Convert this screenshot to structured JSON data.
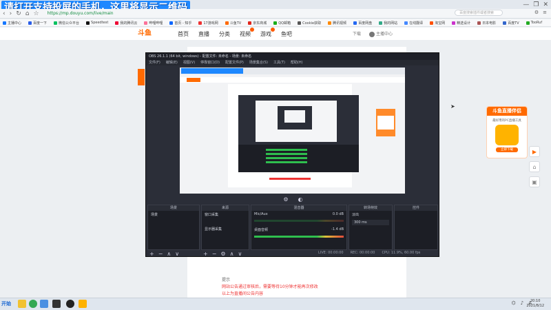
{
  "browser": {
    "banner_text": "请打开支持投屏的手机，这里将显示二维码",
    "url": "https://mp.douyu.com/live/main",
    "search_placeholder": "百度搜索插件或者搜索",
    "bookmarks": [
      "主播中心",
      "百度一下",
      "微信公众平台",
      "Speedtest",
      "我的腾讯云",
      "哔哩哔哩",
      "首页 - 知乎",
      "17游戏网",
      "斗鱼TV",
      "京东商城",
      "QQ邮箱",
      "Cookie获取",
      "腾讯视频",
      "百度网盘",
      "我的网站",
      "在线翻译",
      "淘宝网",
      "精选设计",
      "日本电影",
      "百度TV",
      "TooRuf",
      "更多"
    ],
    "window_controls": [
      "—",
      "❐",
      "✕"
    ]
  },
  "site": {
    "logo": "斗鱼",
    "nav": [
      "首页",
      "直播",
      "分类",
      "视频",
      "游戏",
      "鱼吧"
    ],
    "nav_badges": [
      false,
      false,
      false,
      true,
      true,
      false
    ],
    "right_items": [
      "下载",
      "主播中心"
    ]
  },
  "obs": {
    "title": "OBS 26.1.1 (64 bit, windows) - 配置文件: 未命名 - 场景: 未命名",
    "menu": [
      "文件(F)",
      "编辑(E)",
      "视图(V)",
      "停靠窗口(D)",
      "配置文件(P)",
      "场景集合(S)",
      "工具(T)",
      "帮助(H)"
    ],
    "docks": {
      "scenes": {
        "title": "场景",
        "items": [
          "场景"
        ]
      },
      "sources": {
        "title": "来源",
        "items": [
          "窗口采集",
          "显示器采集"
        ]
      },
      "mixer": {
        "title": "混音器",
        "channels": [
          {
            "name": "Mic/Aux",
            "db": "0.0 dB",
            "level": 0.0
          },
          {
            "name": "桌面音频",
            "db": "-1.4 dB",
            "level": 0.71
          }
        ]
      },
      "transitions": {
        "title": "转场特效",
        "fade": "淡出",
        "duration": "300 ms"
      },
      "controls": {
        "title": "控件"
      }
    },
    "status": [
      "LIVE: 00:00:00",
      "REC: 00:00:00",
      "CPU: 11.9%, 60.00 fps"
    ]
  },
  "content": {
    "note_title": "提示",
    "notes": [
      "网站公告通过审核后，需要等待10分钟才能再次修改",
      "以上为直播间公告内容"
    ]
  },
  "widgets": {
    "live_card_title": "斗鱼直播伴侣",
    "live_card_sub": "最好用的PC直播工具",
    "live_card_button": "立即下载"
  },
  "taskbar": {
    "start": "开始",
    "time": "20:10",
    "date": "2021/8/12"
  }
}
